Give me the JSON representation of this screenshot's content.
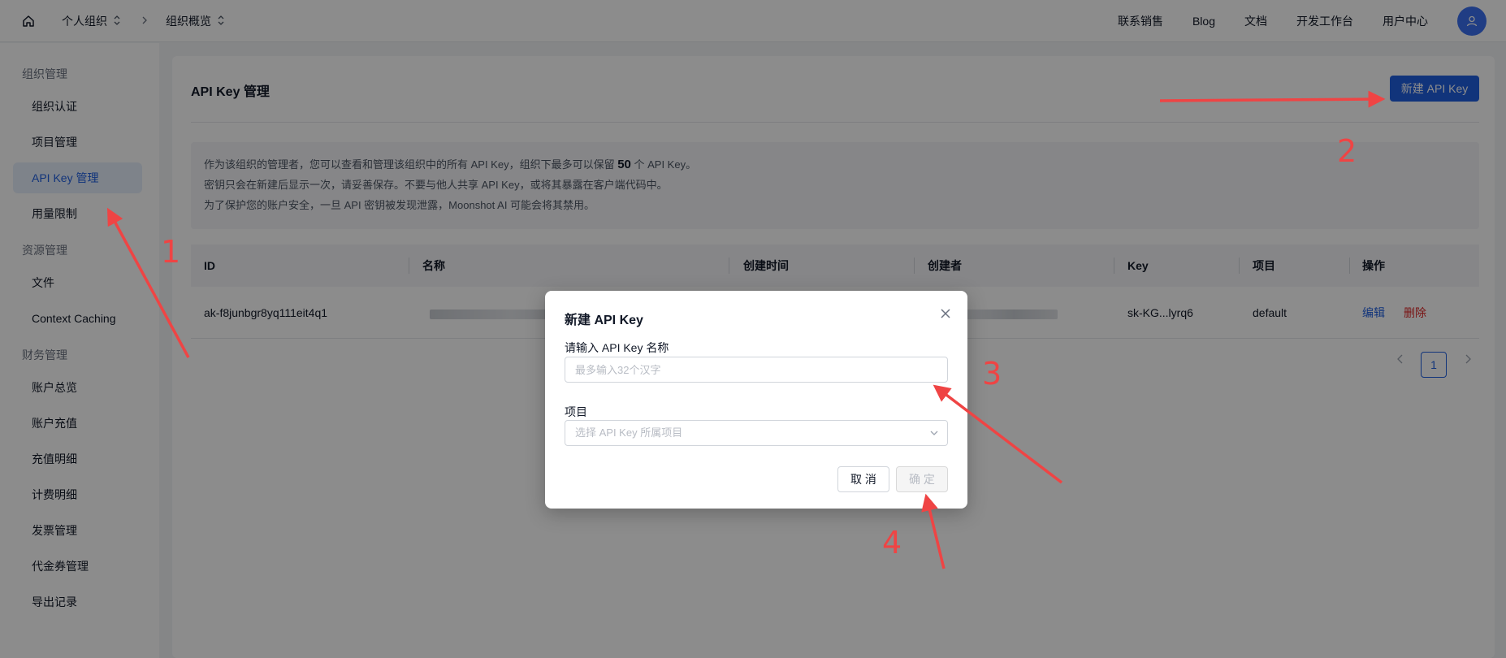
{
  "topbar": {
    "breadcrumb": [
      "个人组织",
      "组织概览"
    ],
    "nav": [
      "联系销售",
      "Blog",
      "文档",
      "开发工作台",
      "用户中心"
    ]
  },
  "sidebar": {
    "groups": [
      {
        "title": "组织管理",
        "items": [
          "组织认证",
          "项目管理",
          "API Key 管理",
          "用量限制"
        ]
      },
      {
        "title": "资源管理",
        "items": [
          "文件",
          "Context Caching"
        ]
      },
      {
        "title": "财务管理",
        "items": [
          "账户总览",
          "账户充值",
          "充值明细",
          "计费明细",
          "发票管理",
          "代金券管理",
          "导出记录"
        ]
      }
    ],
    "active_item": "API Key 管理"
  },
  "main": {
    "title": "API Key 管理",
    "new_button": "新建 API Key",
    "notice": {
      "line1_pre": "作为该组织的管理者，您可以查看和管理该组织中的所有 API Key，组织下最多可以保留 ",
      "line1_num": "50",
      "line1_post": " 个 API Key。",
      "line2": "密钥只会在新建后显示一次，请妥善保存。不要与他人共享 API Key，或将其暴露在客户端代码中。",
      "line3": "为了保护您的账户安全，一旦 API 密钥被发现泄露，Moonshot AI 可能会将其禁用。"
    },
    "table": {
      "columns": [
        "ID",
        "名称",
        "创建时间",
        "创建者",
        "Key",
        "项目",
        "操作"
      ],
      "rows": [
        {
          "id": "ak-f8junbgr8yq111eit4q1",
          "key": "sk-KG...lyrq6",
          "project": "default",
          "edit": "编辑",
          "delete": "删除"
        }
      ]
    },
    "pagination": {
      "current": "1"
    }
  },
  "modal": {
    "title": "新建 API Key",
    "name_label": "请输入 API Key 名称",
    "name_placeholder": "最多输入32个汉字",
    "project_label": "项目",
    "project_placeholder": "选择 API Key 所属项目",
    "cancel": "取 消",
    "ok": "确 定"
  },
  "annotations": [
    "1",
    "2",
    "3",
    "4"
  ],
  "colors": {
    "accent": "#1f5fe0",
    "danger": "#dc2626",
    "annotation": "#ef4444"
  }
}
